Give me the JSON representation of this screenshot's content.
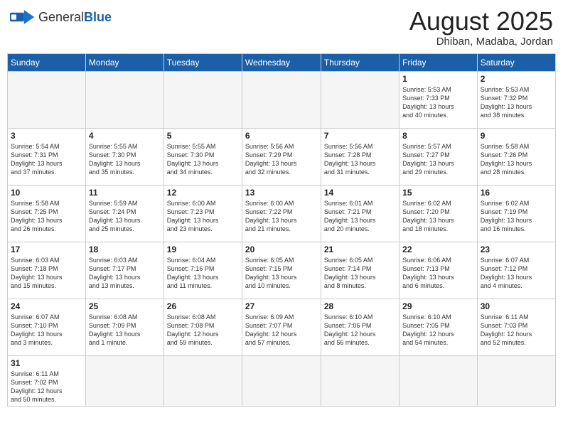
{
  "header": {
    "logo_general": "General",
    "logo_blue": "Blue",
    "title": "August 2025",
    "subtitle": "Dhiban, Madaba, Jordan"
  },
  "weekdays": [
    "Sunday",
    "Monday",
    "Tuesday",
    "Wednesday",
    "Thursday",
    "Friday",
    "Saturday"
  ],
  "weeks": [
    [
      {
        "day": "",
        "info": ""
      },
      {
        "day": "",
        "info": ""
      },
      {
        "day": "",
        "info": ""
      },
      {
        "day": "",
        "info": ""
      },
      {
        "day": "",
        "info": ""
      },
      {
        "day": "1",
        "info": "Sunrise: 5:53 AM\nSunset: 7:33 PM\nDaylight: 13 hours\nand 40 minutes."
      },
      {
        "day": "2",
        "info": "Sunrise: 5:53 AM\nSunset: 7:32 PM\nDaylight: 13 hours\nand 38 minutes."
      }
    ],
    [
      {
        "day": "3",
        "info": "Sunrise: 5:54 AM\nSunset: 7:31 PM\nDaylight: 13 hours\nand 37 minutes."
      },
      {
        "day": "4",
        "info": "Sunrise: 5:55 AM\nSunset: 7:30 PM\nDaylight: 13 hours\nand 35 minutes."
      },
      {
        "day": "5",
        "info": "Sunrise: 5:55 AM\nSunset: 7:30 PM\nDaylight: 13 hours\nand 34 minutes."
      },
      {
        "day": "6",
        "info": "Sunrise: 5:56 AM\nSunset: 7:29 PM\nDaylight: 13 hours\nand 32 minutes."
      },
      {
        "day": "7",
        "info": "Sunrise: 5:56 AM\nSunset: 7:28 PM\nDaylight: 13 hours\nand 31 minutes."
      },
      {
        "day": "8",
        "info": "Sunrise: 5:57 AM\nSunset: 7:27 PM\nDaylight: 13 hours\nand 29 minutes."
      },
      {
        "day": "9",
        "info": "Sunrise: 5:58 AM\nSunset: 7:26 PM\nDaylight: 13 hours\nand 28 minutes."
      }
    ],
    [
      {
        "day": "10",
        "info": "Sunrise: 5:58 AM\nSunset: 7:25 PM\nDaylight: 13 hours\nand 26 minutes."
      },
      {
        "day": "11",
        "info": "Sunrise: 5:59 AM\nSunset: 7:24 PM\nDaylight: 13 hours\nand 25 minutes."
      },
      {
        "day": "12",
        "info": "Sunrise: 6:00 AM\nSunset: 7:23 PM\nDaylight: 13 hours\nand 23 minutes."
      },
      {
        "day": "13",
        "info": "Sunrise: 6:00 AM\nSunset: 7:22 PM\nDaylight: 13 hours\nand 21 minutes."
      },
      {
        "day": "14",
        "info": "Sunrise: 6:01 AM\nSunset: 7:21 PM\nDaylight: 13 hours\nand 20 minutes."
      },
      {
        "day": "15",
        "info": "Sunrise: 6:02 AM\nSunset: 7:20 PM\nDaylight: 13 hours\nand 18 minutes."
      },
      {
        "day": "16",
        "info": "Sunrise: 6:02 AM\nSunset: 7:19 PM\nDaylight: 13 hours\nand 16 minutes."
      }
    ],
    [
      {
        "day": "17",
        "info": "Sunrise: 6:03 AM\nSunset: 7:18 PM\nDaylight: 13 hours\nand 15 minutes."
      },
      {
        "day": "18",
        "info": "Sunrise: 6:03 AM\nSunset: 7:17 PM\nDaylight: 13 hours\nand 13 minutes."
      },
      {
        "day": "19",
        "info": "Sunrise: 6:04 AM\nSunset: 7:16 PM\nDaylight: 13 hours\nand 11 minutes."
      },
      {
        "day": "20",
        "info": "Sunrise: 6:05 AM\nSunset: 7:15 PM\nDaylight: 13 hours\nand 10 minutes."
      },
      {
        "day": "21",
        "info": "Sunrise: 6:05 AM\nSunset: 7:14 PM\nDaylight: 13 hours\nand 8 minutes."
      },
      {
        "day": "22",
        "info": "Sunrise: 6:06 AM\nSunset: 7:13 PM\nDaylight: 13 hours\nand 6 minutes."
      },
      {
        "day": "23",
        "info": "Sunrise: 6:07 AM\nSunset: 7:12 PM\nDaylight: 13 hours\nand 4 minutes."
      }
    ],
    [
      {
        "day": "24",
        "info": "Sunrise: 6:07 AM\nSunset: 7:10 PM\nDaylight: 13 hours\nand 3 minutes."
      },
      {
        "day": "25",
        "info": "Sunrise: 6:08 AM\nSunset: 7:09 PM\nDaylight: 13 hours\nand 1 minute."
      },
      {
        "day": "26",
        "info": "Sunrise: 6:08 AM\nSunset: 7:08 PM\nDaylight: 12 hours\nand 59 minutes."
      },
      {
        "day": "27",
        "info": "Sunrise: 6:09 AM\nSunset: 7:07 PM\nDaylight: 12 hours\nand 57 minutes."
      },
      {
        "day": "28",
        "info": "Sunrise: 6:10 AM\nSunset: 7:06 PM\nDaylight: 12 hours\nand 56 minutes."
      },
      {
        "day": "29",
        "info": "Sunrise: 6:10 AM\nSunset: 7:05 PM\nDaylight: 12 hours\nand 54 minutes."
      },
      {
        "day": "30",
        "info": "Sunrise: 6:11 AM\nSunset: 7:03 PM\nDaylight: 12 hours\nand 52 minutes."
      }
    ],
    [
      {
        "day": "31",
        "info": "Sunrise: 6:11 AM\nSunset: 7:02 PM\nDaylight: 12 hours\nand 50 minutes."
      },
      {
        "day": "",
        "info": ""
      },
      {
        "day": "",
        "info": ""
      },
      {
        "day": "",
        "info": ""
      },
      {
        "day": "",
        "info": ""
      },
      {
        "day": "",
        "info": ""
      },
      {
        "day": "",
        "info": ""
      }
    ]
  ]
}
